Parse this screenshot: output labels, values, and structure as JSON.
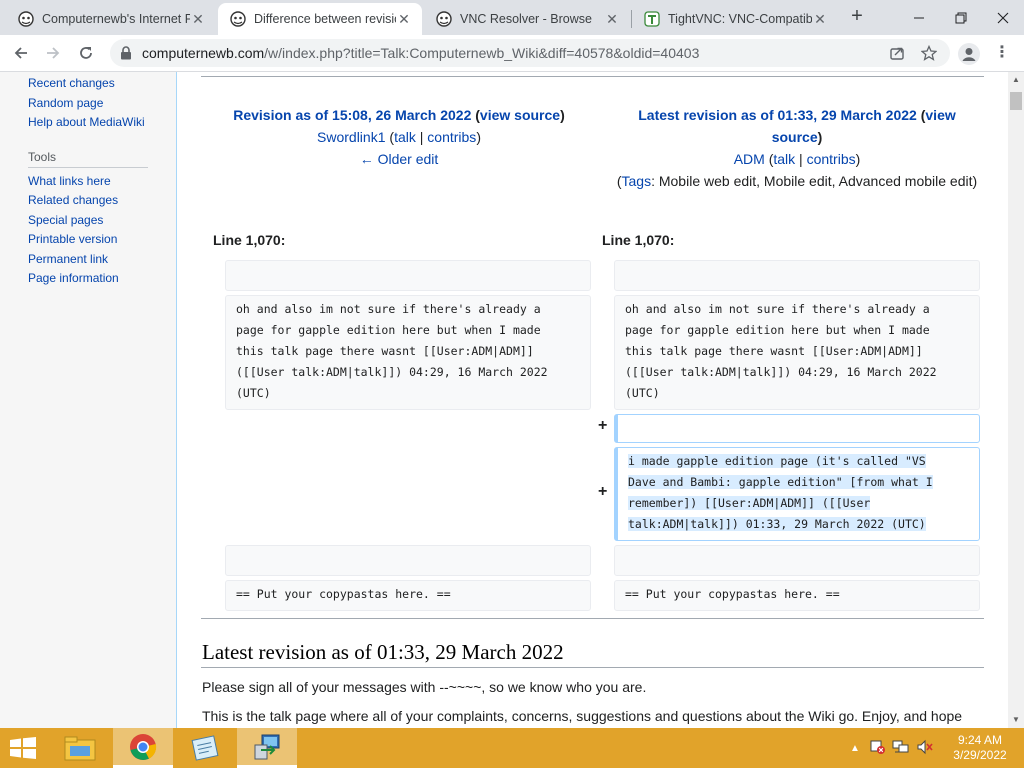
{
  "browser": {
    "tabs": [
      {
        "title": "Computernewb's Internet P",
        "active": false,
        "icon": "wiki-favicon-icon"
      },
      {
        "title": "Difference between revisio",
        "active": true,
        "icon": "wiki-favicon-icon"
      },
      {
        "title": "VNC Resolver - Browse",
        "active": false,
        "icon": "wiki-favicon-icon"
      },
      {
        "title": "TightVNC: VNC-Compatib",
        "active": false,
        "icon": "tightvnc-favicon-icon"
      }
    ],
    "new_tab": "+",
    "url_host": "computernewb.com",
    "url_path": "/w/index.php?title=Talk:Computernewb_Wiki&diff=40578&oldid=40403"
  },
  "sidebar": {
    "nav_links": [
      "Recent changes",
      "Random page",
      "Help about MediaWiki"
    ],
    "tools_heading": "Tools",
    "tools_links": [
      "What links here",
      "Related changes",
      "Special pages",
      "Printable version",
      "Permanent link",
      "Page information"
    ]
  },
  "diff": {
    "left": {
      "title": "Revision as of 15:08, 26 March 2022",
      "view_source": "view source",
      "user": "Swordlink1",
      "talk": "talk",
      "contribs": "contribs",
      "older_edit": "← Older edit",
      "line_label": "Line 1,070:"
    },
    "right": {
      "title_line1": "Latest revision as of 01:33, 29 March 2022",
      "view_source_a": "view",
      "view_source_b": "source",
      "user": "ADM",
      "talk": "talk",
      "contribs": "contribs",
      "tags_label": "Tags",
      "tags": "Mobile web edit, Mobile edit, Advanced mobile edit",
      "line_label": "Line 1,070:"
    },
    "context_text": [
      "oh and also im not sure if there's already a",
      "page for gapple edition here but when I made",
      "this talk page there wasnt [[User:ADM|ADM]]",
      "([[User talk:ADM|talk]]) 04:29, 16 March 2022",
      "(UTC)"
    ],
    "added_text": [
      "i made gapple edition page (it's called \"VS",
      "Dave and Bambi: gapple edition\" [from what I",
      "remember]) [[User:ADM|ADM]] ([[User",
      "talk:ADM|talk]]) 01:33, 29 March 2022 (UTC)"
    ],
    "added_marker": "+",
    "bottom_text": "== Put your copypastas here. =="
  },
  "article": {
    "heading": "Latest revision as of 01:33, 29 March 2022",
    "para1": "Please sign all of your messages with --~~~~, so we know who you are.",
    "para2": "This is the talk page where all of your complaints, concerns, suggestions and questions about the Wiki go. Enjoy, and hope"
  },
  "taskbar": {
    "time": "9:24 AM",
    "date": "3/29/2022"
  },
  "colors": {
    "link": "#0645ad",
    "redlink": "#dd3333",
    "taskbar": "#e1a32a",
    "added_border": "#a3d3ff",
    "added_highlight": "#d8ecff"
  }
}
